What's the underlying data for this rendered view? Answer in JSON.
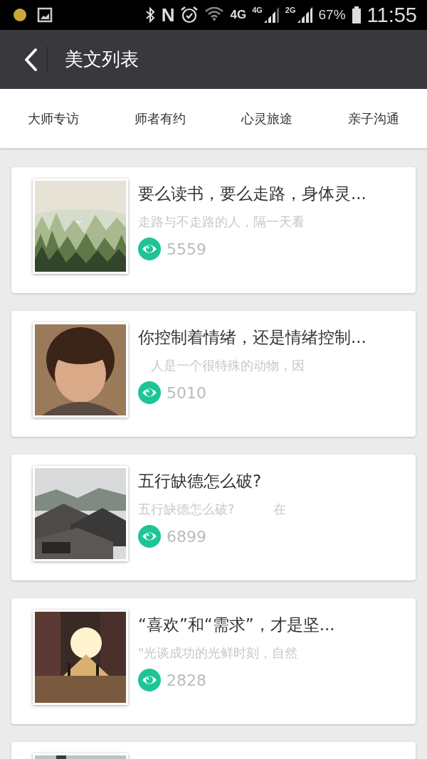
{
  "status_bar": {
    "nfc": "N",
    "network": "4G",
    "sim1": "4G",
    "sim2": "2G",
    "battery": "67%",
    "time": "11:55"
  },
  "header": {
    "title": "美文列表"
  },
  "tabs": [
    {
      "label": "大师专访"
    },
    {
      "label": "师者有约"
    },
    {
      "label": "心灵旅途"
    },
    {
      "label": "亲子沟通"
    }
  ],
  "articles": [
    {
      "kind": "article",
      "title": "要么读书，要么走路，身体灵...",
      "excerpt": "走路与不走路的人，隔一天看",
      "views": "5559"
    },
    {
      "kind": "article",
      "title": "你控制着情绪，还是情绪控制...",
      "excerpt": "　人是一个很特殊的动物，因",
      "views": "5010"
    },
    {
      "kind": "article",
      "title": "五行缺德怎么破?",
      "excerpt": "五行缺德怎么破?　　　在",
      "views": "6899"
    },
    {
      "kind": "article",
      "title": "“喜欢”和“需求”，才是坚...",
      "excerpt": "\"光谈成功的光鲜时刻，自然",
      "views": "2828"
    },
    {
      "kind": "picture"
    }
  ]
}
